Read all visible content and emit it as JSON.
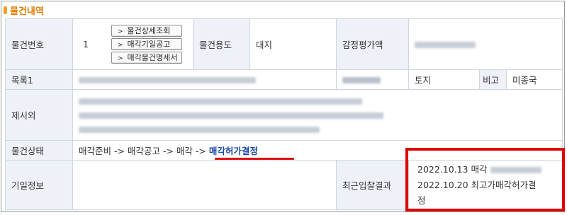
{
  "section": {
    "title": "물건내역"
  },
  "rows": {
    "r1": {
      "label_no": "물건번호",
      "no_value": "1",
      "buttons": [
        "물건상세조회",
        "매각기일공고",
        "매각물건명세서"
      ],
      "label_use": "물건용도",
      "use_value": "대지",
      "label_appraisal": "감정평가액"
    },
    "r2": {
      "label": "목록1",
      "type": "토지",
      "note_label": "비고",
      "note_value": "미종국"
    },
    "r3": {
      "label": "제시외"
    },
    "r4": {
      "label": "물건상태",
      "steps": [
        "매각준비",
        "매각공고",
        "매각"
      ],
      "arrow": " -> ",
      "current": "매각허가결정"
    },
    "r5": {
      "label": "기일정보",
      "label_recent": "최근입찰결과",
      "line1_prefix": "2022.10.13 매각",
      "line2a": "2022.10.20 최고가매각허가결",
      "line2b": "정"
    }
  },
  "colors": {
    "accent": "#e07a00",
    "header_bg": "#eef2f8",
    "highlight": "#e30000",
    "status_link": "#1a4ba8"
  }
}
